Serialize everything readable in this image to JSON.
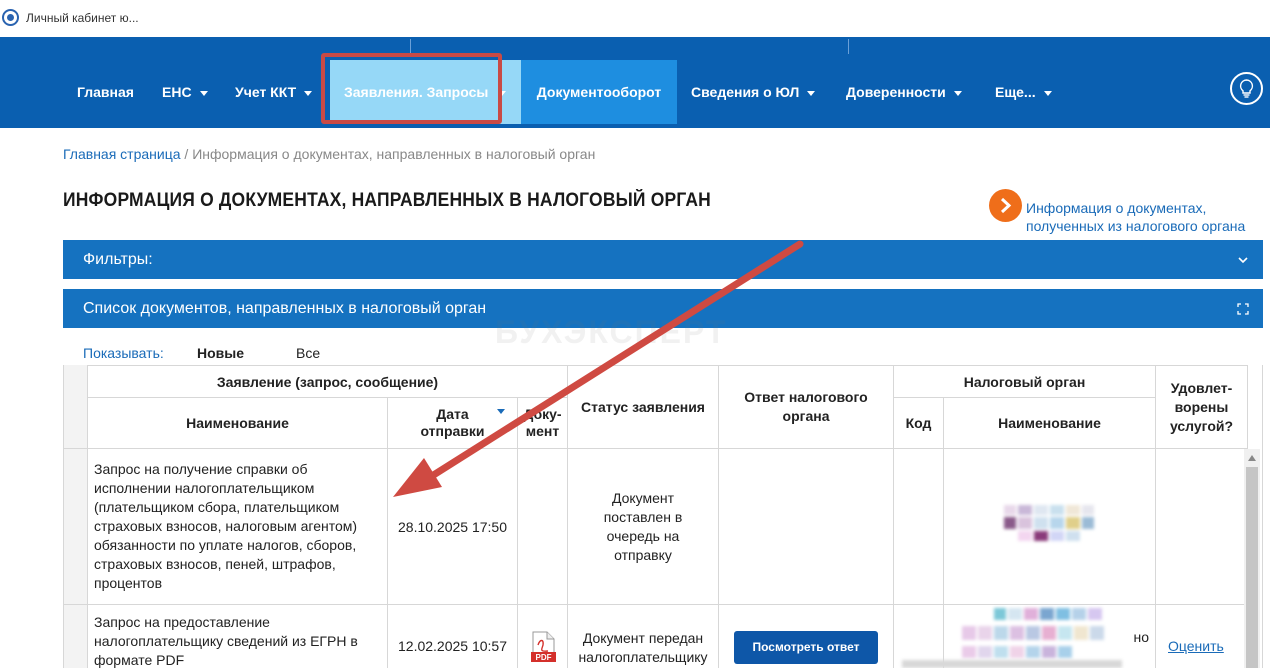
{
  "window": {
    "tab_title": "Личный кабинет ю..."
  },
  "nav": {
    "items": [
      {
        "label": "Главная",
        "dropdown": false
      },
      {
        "label": "ЕНС",
        "dropdown": true
      },
      {
        "label": "Учет ККТ",
        "dropdown": true
      },
      {
        "label": "Заявления. Запросы",
        "dropdown": true,
        "active": true
      },
      {
        "label": "Документооборот",
        "dropdown": false
      },
      {
        "label": "Сведения о ЮЛ",
        "dropdown": true
      },
      {
        "label": "Доверенности",
        "dropdown": true
      },
      {
        "label": "Еще...",
        "dropdown": true
      }
    ]
  },
  "breadcrumb": {
    "home": "Главная страница",
    "separator": " / ",
    "current": "Информация о документах, направленных в налоговый орган"
  },
  "page": {
    "title": "ИНФОРМАЦИЯ О ДОКУМЕНТАХ, НАПРАВЛЕННЫХ В НАЛОГОВЫЙ ОРГАН",
    "side_link_line1": "Информация о документах,",
    "side_link_line2": "полученных из налогового органа"
  },
  "panels": {
    "filters": "Фильтры:",
    "list": "Список документов, направленных в налоговый орган"
  },
  "watermark": "БУХЭКСПЕРТ",
  "show": {
    "label": "Показывать:",
    "option_new": "Новые",
    "option_all": "Все"
  },
  "table": {
    "group_application": "Заявление (запрос, сообщение)",
    "col_name": "Наименование",
    "col_date": "Дата отправки",
    "col_doc": "Доку-мент",
    "col_status": "Статус заявления",
    "col_answer": "Ответ налогового органа",
    "group_tax": "Налоговый орган",
    "col_code": "Код",
    "col_tax_name": "Наименование",
    "col_satisfied": "Удовлет-ворены услугой?",
    "rows": [
      {
        "name": "Запрос на получение справки об исполнении налогоплательщиком (плательщиком сбора, плательщиком страховых взносов, налоговым агентом) обязанности по уплате налогов, сборов, страховых взносов, пеней, штрафов, процентов",
        "date": "28.10.2025 17:50",
        "status": "Документ поставлен в очередь на отправку"
      },
      {
        "name": "Запрос на предоставление налогоплательщику сведений из ЕГРН в формате PDF",
        "date": "12.02.2025 10:57",
        "status": "Документ передан налогоплательщику",
        "answer_button": "Посмотреть ответ",
        "rate_link": "Оценить",
        "tax_name_suffix": "но"
      }
    ]
  },
  "colors": {
    "nav_bg": "#0a5fb0",
    "nav_active_bg": "#96d8f7",
    "nav_doc_bg": "#1e8ee0",
    "panel_bg": "#1572c0",
    "link": "#1a6bb8",
    "highlight": "#c94a45",
    "orange_icon": "#ef6e1a"
  },
  "icons": [
    "lightbulb-icon",
    "arrow-right-circle-icon",
    "chevron-down-icon",
    "expand-icon",
    "pdf-icon"
  ]
}
